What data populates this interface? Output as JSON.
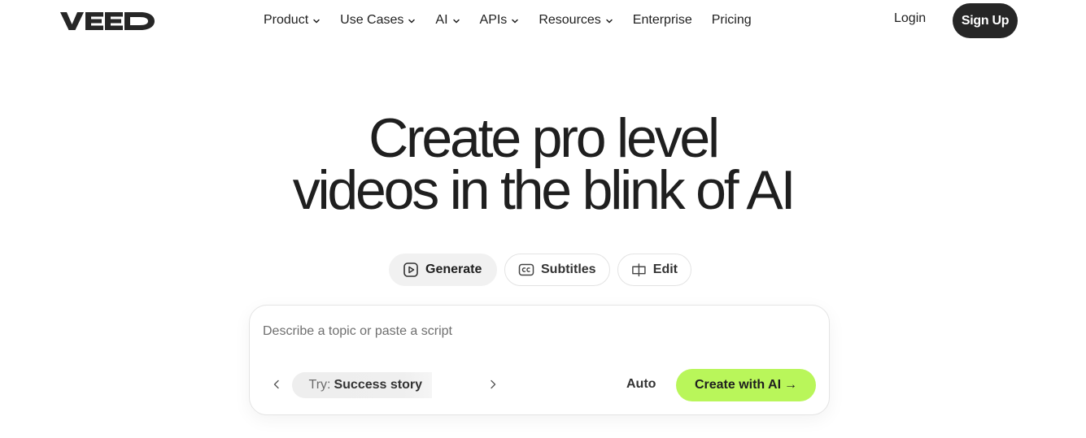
{
  "header": {
    "logo_text": "VEED",
    "nav": [
      {
        "label": "Product",
        "has_dropdown": true
      },
      {
        "label": "Use Cases",
        "has_dropdown": true
      },
      {
        "label": "AI",
        "has_dropdown": true
      },
      {
        "label": "APIs",
        "has_dropdown": true
      },
      {
        "label": "Resources",
        "has_dropdown": true
      },
      {
        "label": "Enterprise",
        "has_dropdown": false
      },
      {
        "label": "Pricing",
        "has_dropdown": false
      }
    ],
    "login_label": "Login",
    "signup_label": "Sign Up"
  },
  "hero": {
    "title_line1": "Create pro level",
    "title_line2": "videos in the blink of AI"
  },
  "modes": [
    {
      "label": "Generate",
      "icon": "play-square-icon",
      "active": true
    },
    {
      "label": "Subtitles",
      "icon": "closed-captions-icon",
      "active": false
    },
    {
      "label": "Edit",
      "icon": "edit-cut-icon",
      "active": false
    }
  ],
  "prompt": {
    "placeholder": "Describe a topic or paste a script",
    "value": "",
    "suggestion_prefix": "Try:",
    "suggestion_text": "Success story",
    "auto_label": "Auto",
    "create_label": "Create with AI",
    "create_arrow": "→"
  },
  "colors": {
    "accent_green": "#b9f65a",
    "signup_bg": "#262626",
    "text": "#1f1f1f"
  }
}
